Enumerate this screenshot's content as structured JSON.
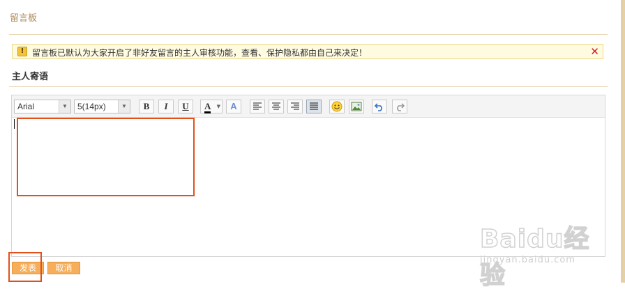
{
  "page": {
    "title": "留言板"
  },
  "notice": {
    "text": "留言板已默认为大家开启了非好友留言的主人审核功能，查看、保护隐私都由自己来决定！",
    "icon": "exclamation-icon",
    "close_label": "✕"
  },
  "section": {
    "title": "主人寄语"
  },
  "editor": {
    "font_family": "Arial",
    "font_size": "5(14px)",
    "bold_label": "B",
    "italic_label": "I",
    "underline_label": "U",
    "font_color_label": "A",
    "highlight_label": "A",
    "content": ""
  },
  "actions": {
    "submit_label": "发表",
    "cancel_label": "取消"
  },
  "watermark": {
    "brand": "Baidu经验",
    "url": "jingyan.baidu.com"
  },
  "colors": {
    "accent": "#f6ae5b",
    "highlight_box": "#e2501a",
    "notice_bg": "#fffbe1",
    "title": "#b08a5c",
    "close": "#d01f1f"
  }
}
